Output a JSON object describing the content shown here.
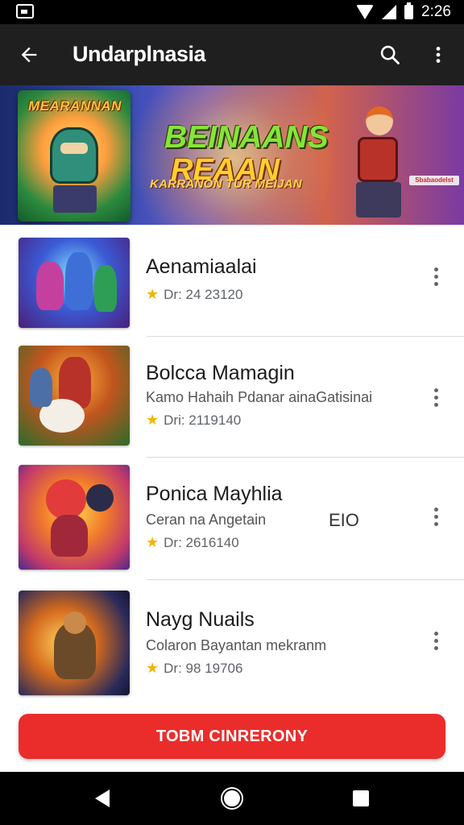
{
  "status_bar": {
    "time": "2:26",
    "icons": [
      "gallery-icon",
      "wifi-icon",
      "signal-icon",
      "battery-icon"
    ]
  },
  "app_bar": {
    "title": "Undarplnasia",
    "icons": [
      "back-arrow-icon",
      "search-icon",
      "more-vert-icon"
    ]
  },
  "banner": {
    "poster_title": "MEARANNAN",
    "title_line1": "BEINAANS",
    "title_line2": "REAAN",
    "subtitle": "KARRANON TUR MEIJAN",
    "badge": "Sbabaodelst"
  },
  "list": {
    "items": [
      {
        "title": "Aenamiaalai",
        "subtitle": "",
        "meta": "Dr: 24 23120",
        "extra": ""
      },
      {
        "title": "Bolcca Mamagin",
        "subtitle": "Kamo Hahaih Pdanar ainaGatisinai",
        "meta": "Dri: 2119140",
        "extra": ""
      },
      {
        "title": "Ponica Mayhlia",
        "subtitle": "Ceran na Angetain",
        "meta": "Dr: 2616140",
        "extra": "EIO"
      },
      {
        "title": "Nayg Nuails",
        "subtitle": "Colaron Bayantan mekranm",
        "meta": "Dr: 98 19706",
        "extra": ""
      }
    ]
  },
  "cta": {
    "label": "TOBM CINRERONY"
  },
  "colors": {
    "accent": "#ea2d2b",
    "app_bar": "#1f1f1f",
    "star": "#f4b400"
  }
}
